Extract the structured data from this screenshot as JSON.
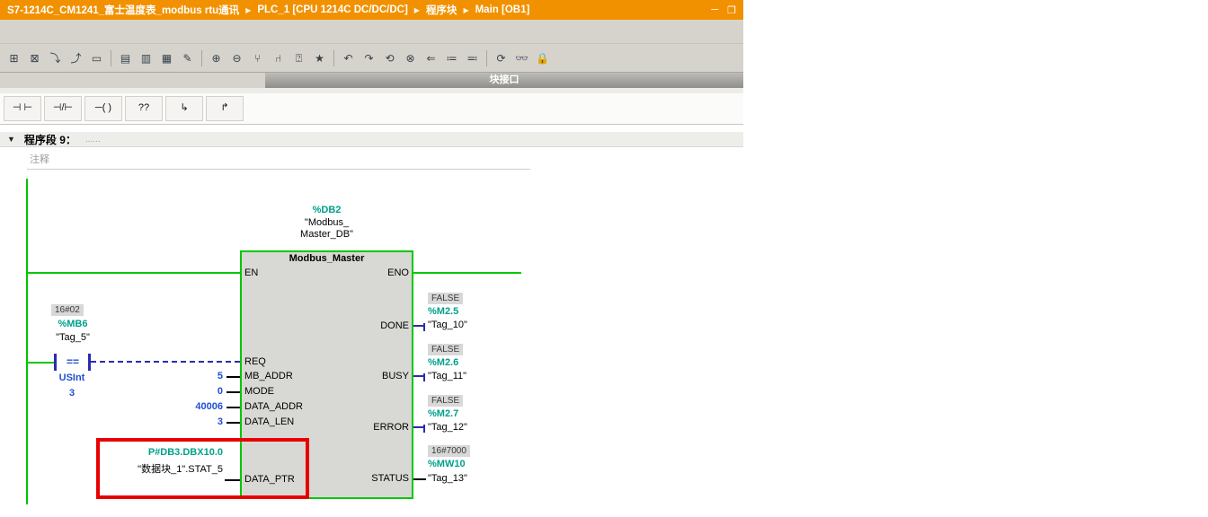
{
  "window": {
    "breadcrumb": [
      "S7-1214C_CM1241_富士温度表_modbus rtu通讯",
      "PLC_1 [CPU 1214C DC/DC/DC]",
      "程序块",
      "Main [OB1]"
    ],
    "separator_glyph": "▶",
    "controls": {
      "minimize": "─",
      "dock": "❐"
    }
  },
  "toolbar": {
    "icons": [
      {
        "name": "insert-network-icon",
        "glyph": "⊞"
      },
      {
        "name": "delete-network-icon",
        "glyph": "⊠"
      },
      {
        "name": "insert-row-icon",
        "glyph": "⤵"
      },
      {
        "name": "add-row-icon",
        "glyph": "⤴"
      },
      {
        "name": "select-block-icon",
        "glyph": "▭"
      },
      {
        "name": "expand-all-networks-icon",
        "glyph": "▤"
      },
      {
        "name": "collapse-all-networks-icon",
        "glyph": "▥"
      },
      {
        "name": "absolute-symbolic-toggle-icon",
        "glyph": "▦"
      },
      {
        "name": "network-comments-icon",
        "glyph": "✎"
      },
      {
        "name": "insert-input-icon",
        "glyph": "⊕"
      },
      {
        "name": "remove-input-icon",
        "glyph": "⊖"
      },
      {
        "name": "open-branch-icon",
        "glyph": "⑂"
      },
      {
        "name": "close-branch-icon",
        "glyph": "⑁"
      },
      {
        "name": "empty-box-icon",
        "glyph": "⍰"
      },
      {
        "name": "favorites-icon",
        "glyph": "★"
      },
      {
        "name": "previous-error-icon",
        "glyph": "↶"
      },
      {
        "name": "next-error-icon",
        "glyph": "↷"
      },
      {
        "name": "update-block-calls-icon",
        "glyph": "⟲"
      },
      {
        "name": "consistency-error-icon",
        "glyph": "⊗"
      },
      {
        "name": "compare-values-icon",
        "glyph": "⇐"
      },
      {
        "name": "snapshot-values-icon",
        "glyph": "≔"
      },
      {
        "name": "apply-snapshot-icon",
        "glyph": "≕"
      },
      {
        "name": "load-start-values-icon",
        "glyph": "⟳"
      },
      {
        "name": "monitoring-glasses-icon",
        "glyph": "👓"
      },
      {
        "name": "lock-icon",
        "glyph": "🔒"
      }
    ]
  },
  "interface_bar": {
    "label": "块接口"
  },
  "lad_toolbar": {
    "buttons": [
      {
        "name": "open-contact",
        "glyph": "⊣ ⊢"
      },
      {
        "name": "closed-contact",
        "glyph": "⊣/⊢"
      },
      {
        "name": "coil",
        "glyph": "─( )"
      },
      {
        "name": "empty-box",
        "glyph": "??"
      },
      {
        "name": "open-branch",
        "glyph": "↳"
      },
      {
        "name": "close-branch",
        "glyph": "↱"
      }
    ]
  },
  "network": {
    "collapse_glyph": "▼",
    "title": "程序段 9：",
    "dots": "......",
    "comment_placeholder": "注释"
  },
  "ladder": {
    "db_call": {
      "db": "%DB2",
      "name_line1": "\"Modbus_",
      "name_line2": "Master_DB\""
    },
    "block": {
      "title": "Modbus_Master",
      "pins_left": [
        "EN",
        "REQ",
        "MB_ADDR",
        "MODE",
        "DATA_ADDR",
        "DATA_LEN",
        "DATA_PTR"
      ],
      "pins_right": [
        "ENO",
        "DONE",
        "BUSY",
        "ERROR",
        "STATUS"
      ]
    },
    "compare_contact": {
      "monitor_value": "16#02",
      "address": "%MB6",
      "tag": "\"Tag_5\"",
      "operator": "==",
      "data_type": "USInt",
      "compare_value": "3"
    },
    "input_values": {
      "mb_addr": "5",
      "mode": "0",
      "data_addr": "40006",
      "data_len": "3"
    },
    "data_ptr": {
      "pointer": "P#DB3.DBX10.0",
      "operand": "\"数据块_1\".STAT_5"
    },
    "outputs": [
      {
        "monitor_value": "FALSE",
        "address": "%M2.5",
        "tag": "\"Tag_10\""
      },
      {
        "monitor_value": "FALSE",
        "address": "%M2.6",
        "tag": "\"Tag_11\""
      },
      {
        "monitor_value": "FALSE",
        "address": "%M2.7",
        "tag": "\"Tag_12\""
      },
      {
        "monitor_value": "16#7000",
        "address": "%MW10",
        "tag": "\"Tag_13\""
      }
    ]
  },
  "colors": {
    "title_bar": "#F29100",
    "wire_true": "#00C800",
    "wire_false": "#2B2BB0",
    "operand": "#00A08C",
    "constant": "#2050D0",
    "monitor_chip_bg": "#D8D8D8",
    "block_fill": "#D8D8D4",
    "highlight": "#E80000"
  }
}
